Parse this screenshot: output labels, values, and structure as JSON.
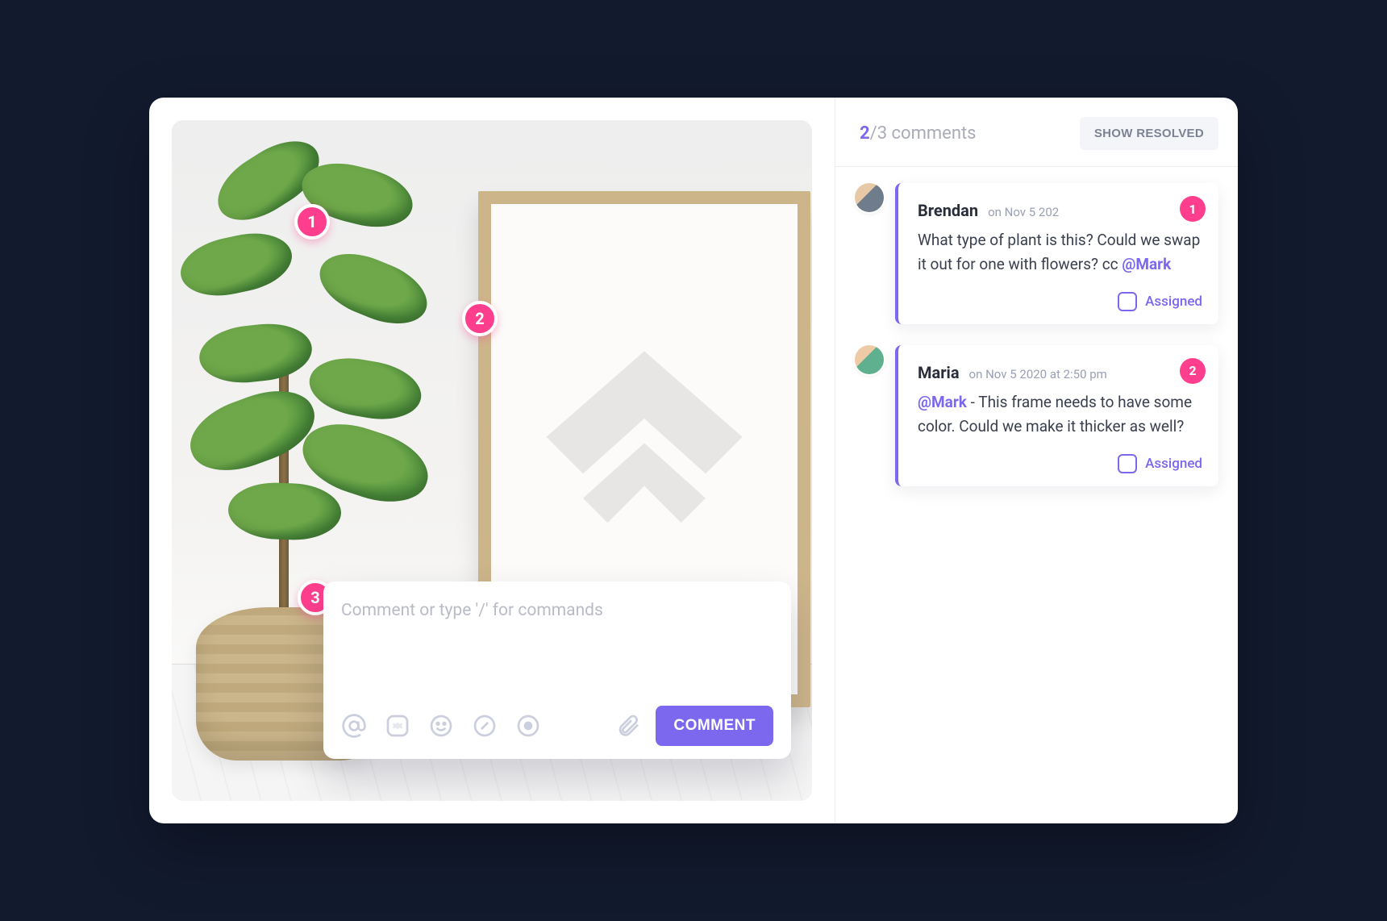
{
  "sidebar": {
    "count_visible": "2",
    "count_total_suffix": "/3 comments",
    "show_resolved_label": "SHOW RESOLVED"
  },
  "composer": {
    "placeholder": "Comment or type '/' for commands",
    "submit_label": "COMMENT"
  },
  "markers": {
    "m1": "1",
    "m2": "2",
    "m3": "3"
  },
  "threads": [
    {
      "author": "Brendan",
      "timestamp": "on Nov 5 202",
      "marker": "1",
      "body_pre": "What type of plant is this? Could we swap it out for one with flowers? cc ",
      "mention": "@Mark",
      "body_post": "",
      "assigned_label": "Assigned"
    },
    {
      "author": "Maria",
      "timestamp": "on Nov 5 2020 at 2:50 pm",
      "marker": "2",
      "body_pre": "",
      "mention": "@Mark",
      "body_post": " - This frame needs to have some color. Could we make it thicker as well?",
      "assigned_label": "Assigned"
    }
  ]
}
